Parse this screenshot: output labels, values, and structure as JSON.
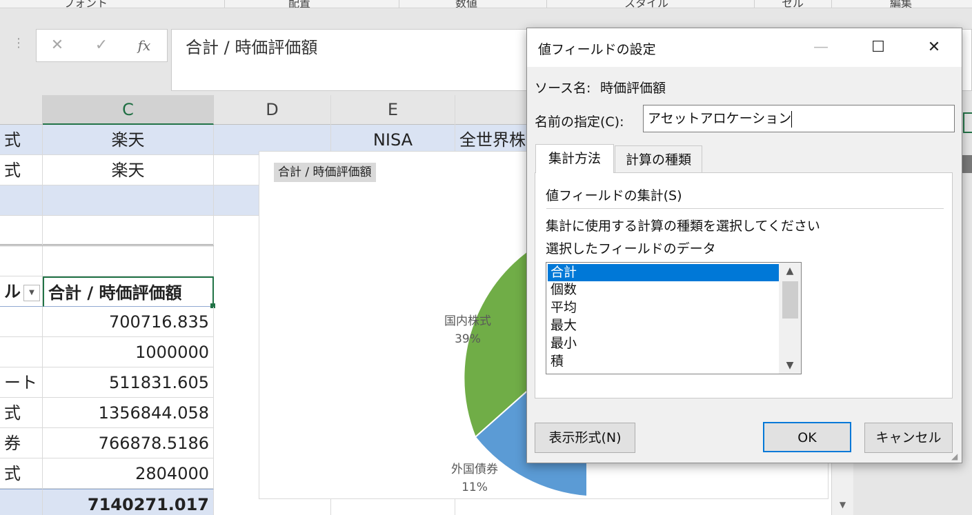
{
  "ribbon": {
    "groups": [
      "フォント",
      "配置",
      "数値",
      "スタイル",
      "セル",
      "編集"
    ]
  },
  "formula_bar": {
    "cancel_glyph": "✕",
    "enter_glyph": "✓",
    "fx_label": "fx",
    "content": "合計 / 時価評価額"
  },
  "sheet": {
    "columns": [
      "C",
      "D",
      "E"
    ],
    "rows": {
      "r1": {
        "b": "式",
        "c": "楽天",
        "e": "NISA",
        "f": "全世界株"
      },
      "r2": {
        "b": "式",
        "c": "楽天"
      },
      "header": {
        "b": "ル",
        "c": "合計 / 時価評価額"
      },
      "data": [
        {
          "b": "",
          "c": "700716.835"
        },
        {
          "b": "",
          "c": "1000000"
        },
        {
          "b": "ート",
          "c": "511831.605"
        },
        {
          "b": "式",
          "c": "1356844.058"
        },
        {
          "b": "券",
          "c": "766878.5186"
        },
        {
          "b": "式",
          "c": "2804000"
        }
      ],
      "total": {
        "c": "7140271.017"
      }
    }
  },
  "chart": {
    "title_button": "合計 / 時価評価額",
    "labels": [
      {
        "name": "国内株式",
        "pct": "39%"
      },
      {
        "name": "外国債券",
        "pct": "11%"
      }
    ],
    "colors": {
      "green": "#70ad47",
      "blue": "#5b9bd5"
    }
  },
  "dialog": {
    "title": "値フィールドの設定",
    "minimize": "—",
    "maximize": "☐",
    "close": "✕",
    "source_label": "ソース名:",
    "source_value": "時価評価額",
    "name_label": "名前の指定(C):",
    "name_value": "アセットアロケーション",
    "tabs": [
      "集計方法",
      "計算の種類"
    ],
    "section_title": "値フィールドの集計(S)",
    "instruction": "集計に使用する計算の種類を選択してください",
    "data_label": "選択したフィールドのデータ",
    "functions": [
      "合計",
      "個数",
      "平均",
      "最大",
      "最小",
      "積"
    ],
    "selected_function": "合計",
    "format_button": "表示形式(N)",
    "ok_button": "OK",
    "cancel_button": "キャンセル"
  }
}
